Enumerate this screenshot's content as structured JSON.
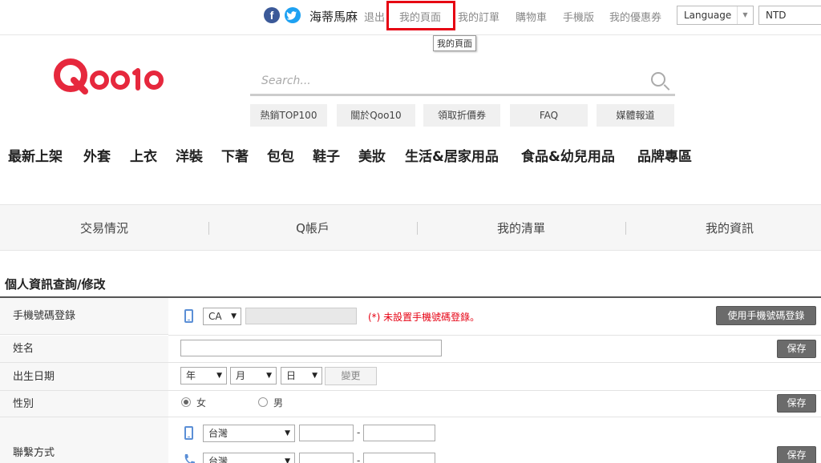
{
  "topbar": {
    "facebook_glyph": "f",
    "username": "海蒂馬麻",
    "logout": "退出",
    "my_page": "我的頁面",
    "my_orders": "我的訂單",
    "cart": "購物車",
    "mobile": "手機版",
    "coupons": "我的優惠券",
    "language_label": "Language",
    "currency_label": "NTD",
    "tooltip": "我的頁面"
  },
  "logo": {
    "text": "Qoo10",
    "color": "#e6283d"
  },
  "search": {
    "placeholder": "Search..."
  },
  "quick_links": [
    "熱銷TOP100",
    "關於Qoo10",
    "領取折價券",
    "FAQ",
    "媒體報道"
  ],
  "categories": [
    "最新上架",
    "外套",
    "上衣",
    "洋裝",
    "下著",
    "包包",
    "鞋子",
    "美妝",
    "生活&居家用品",
    "食品&幼兒用品",
    "品牌專區"
  ],
  "tabs": [
    "交易情況",
    "Q帳戶",
    "我的清單",
    "我的資訊"
  ],
  "section_title": "個人資訊查詢/修改",
  "form": {
    "phone_login": {
      "label": "手機號碼登錄",
      "country": "CA",
      "warning": "(*) 未設置手機號碼登錄。",
      "button": "使用手機號碼登錄"
    },
    "name": {
      "label": "姓名",
      "value": "",
      "save": "保存"
    },
    "birthday": {
      "label": "出生日期",
      "year": "年",
      "month": "月",
      "day": "日",
      "change": "變更"
    },
    "gender": {
      "label": "性別",
      "female": "女",
      "male": "男",
      "selected": "女",
      "save": "保存"
    },
    "contact": {
      "label": "聯繫方式",
      "country1": "台灣",
      "country2": "台灣",
      "dash": "-",
      "save": "保存"
    }
  },
  "colors": {
    "accent_red": "#e60012",
    "facebook": "#3b5998",
    "twitter": "#1da1f2",
    "phone_icon": "#5b8fd6",
    "warning": "#e60012"
  }
}
